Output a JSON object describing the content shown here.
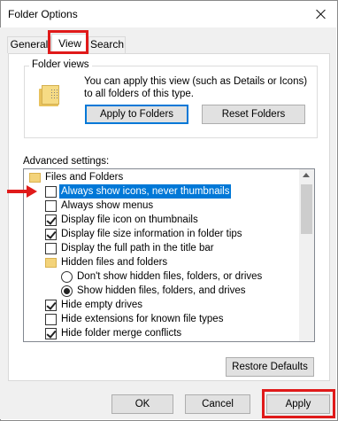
{
  "window": {
    "title": "Folder Options"
  },
  "tabs": [
    {
      "label": "General"
    },
    {
      "label": "View"
    },
    {
      "label": "Search"
    }
  ],
  "folder_views": {
    "title": "Folder views",
    "description": "You can apply this view (such as Details or Icons) to all folders of this type.",
    "apply_button": "Apply to Folders",
    "reset_button": "Reset Folders"
  },
  "advanced": {
    "label": "Advanced settings:",
    "items": [
      {
        "type": "folder",
        "label": "Files and Folders"
      },
      {
        "type": "checkbox",
        "checked": false,
        "selected": true,
        "label": "Always show icons, never thumbnails"
      },
      {
        "type": "checkbox",
        "checked": false,
        "label": "Always show menus"
      },
      {
        "type": "checkbox",
        "checked": true,
        "label": "Display file icon on thumbnails"
      },
      {
        "type": "checkbox",
        "checked": true,
        "label": "Display file size information in folder tips"
      },
      {
        "type": "checkbox",
        "checked": false,
        "label": "Display the full path in the title bar"
      },
      {
        "type": "folder",
        "label": "Hidden files and folders"
      },
      {
        "type": "radio",
        "checked": false,
        "label": "Don't show hidden files, folders, or drives"
      },
      {
        "type": "radio",
        "checked": true,
        "label": "Show hidden files, folders, and drives"
      },
      {
        "type": "checkbox",
        "checked": true,
        "label": "Hide empty drives"
      },
      {
        "type": "checkbox",
        "checked": false,
        "label": "Hide extensions for known file types"
      },
      {
        "type": "checkbox",
        "checked": true,
        "label": "Hide folder merge conflicts"
      }
    ],
    "restore_button": "Restore Defaults"
  },
  "footer": {
    "ok": "OK",
    "cancel": "Cancel",
    "apply": "Apply"
  },
  "colors": {
    "highlight": "#0078d7",
    "annotation_red": "#e01a1a"
  }
}
